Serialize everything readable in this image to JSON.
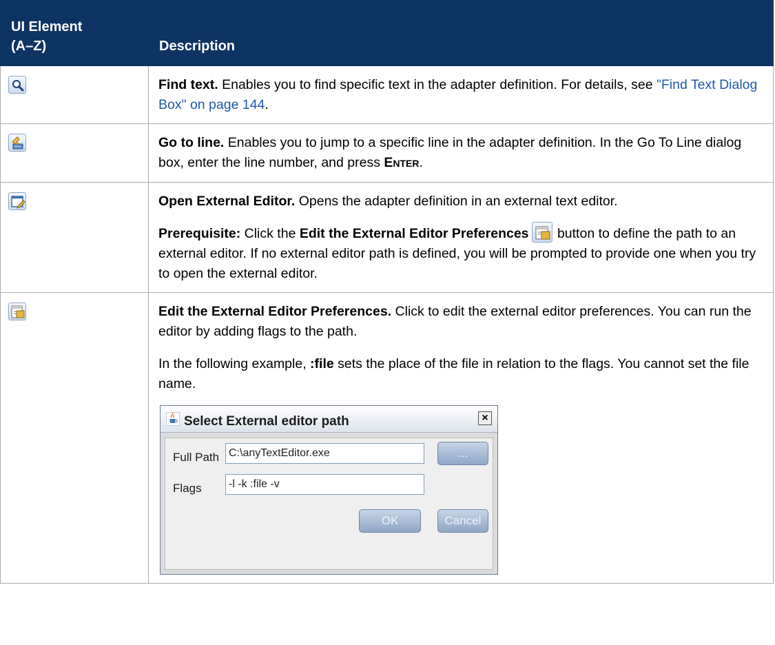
{
  "table": {
    "header_col1_line1": "UI Element",
    "header_col1_line2": "(A–Z)",
    "header_col2": "Description"
  },
  "rows": [
    {
      "icon": "find-text-icon",
      "title": "Find text.",
      "text1": " Enables you to find specific text in the adapter definition. For details, see ",
      "link": "\"Find Text Dialog Box\" on page 144",
      "text2": "."
    },
    {
      "icon": "go-to-line-icon",
      "title": "Go to line.",
      "text1": " Enables you to jump to a specific line in the adapter definition. In the Go To Line dialog box, enter the line number, and press ",
      "key_first": "E",
      "key_rest": "NTER",
      "text2": "."
    },
    {
      "icon": "open-external-editor-icon",
      "title": "Open External Editor.",
      "text1": " Opens the adapter definition in an external text editor.",
      "prereq_label": "Prerequisite:",
      "prereq_text1": " Click the ",
      "prereq_bold": "Edit the External Editor Preferences",
      "prereq_text2": " button to define the path to an external editor. If no external editor path is defined, you will be prompted to provide one when you try to open the external editor."
    },
    {
      "icon": "edit-preferences-icon",
      "title": "Edit the External Editor Preferences.",
      "text1": " Click to edit the external editor preferences. You can run the editor by adding flags to the path.",
      "example_text1": "In the following example, ",
      "example_bold": ":file",
      "example_text2": " sets the place of the file in relation to the flags. You cannot set the file name."
    }
  ],
  "dialog": {
    "title": "Select External editor path",
    "close_glyph": "×",
    "full_path_label": "Full Path",
    "full_path_value": "C:\\anyTextEditor.exe",
    "browse_label": "...",
    "flags_label": "Flags",
    "flags_value": "-l -k :file -v",
    "ok_label": "OK",
    "cancel_label": "Cancel"
  }
}
